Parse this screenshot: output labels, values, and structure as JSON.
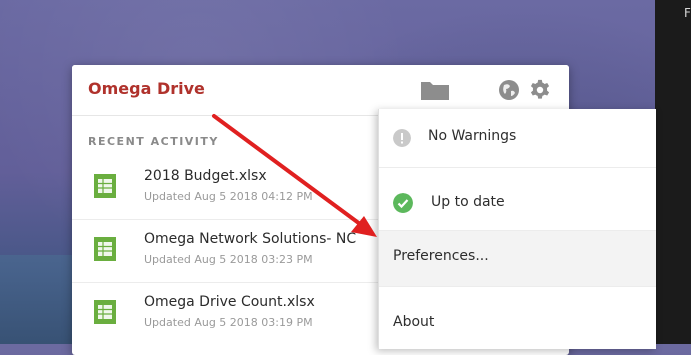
{
  "window": {
    "title": "Omega Drive",
    "icons": [
      "folder-icon",
      "globe-icon",
      "gear-icon"
    ]
  },
  "recent": {
    "section_label": "RECENT ACTIVITY",
    "items": [
      {
        "name": "2018 Budget.xlsx",
        "meta": "Updated Aug 5 2018 04:12 PM"
      },
      {
        "name": "Omega Network Solutions- NC",
        "meta": "Updated Aug 5 2018 03:23 PM"
      },
      {
        "name": "Omega Drive Count.xlsx",
        "meta": "Updated Aug 5 2018 03:19 PM"
      }
    ]
  },
  "menu": {
    "items": [
      {
        "label": "No Warnings",
        "icon": "info-icon"
      },
      {
        "label": "Up to date",
        "icon": "checkmark-icon"
      },
      {
        "label": "Preferences...",
        "icon": ""
      },
      {
        "label": "About",
        "icon": ""
      }
    ]
  },
  "colors": {
    "brand": "#b0322c",
    "spreadsheet_icon": "#6aae3f",
    "ok_status": "#5cb85c",
    "annotation_arrow": "#e02020"
  },
  "corner_text": "F"
}
